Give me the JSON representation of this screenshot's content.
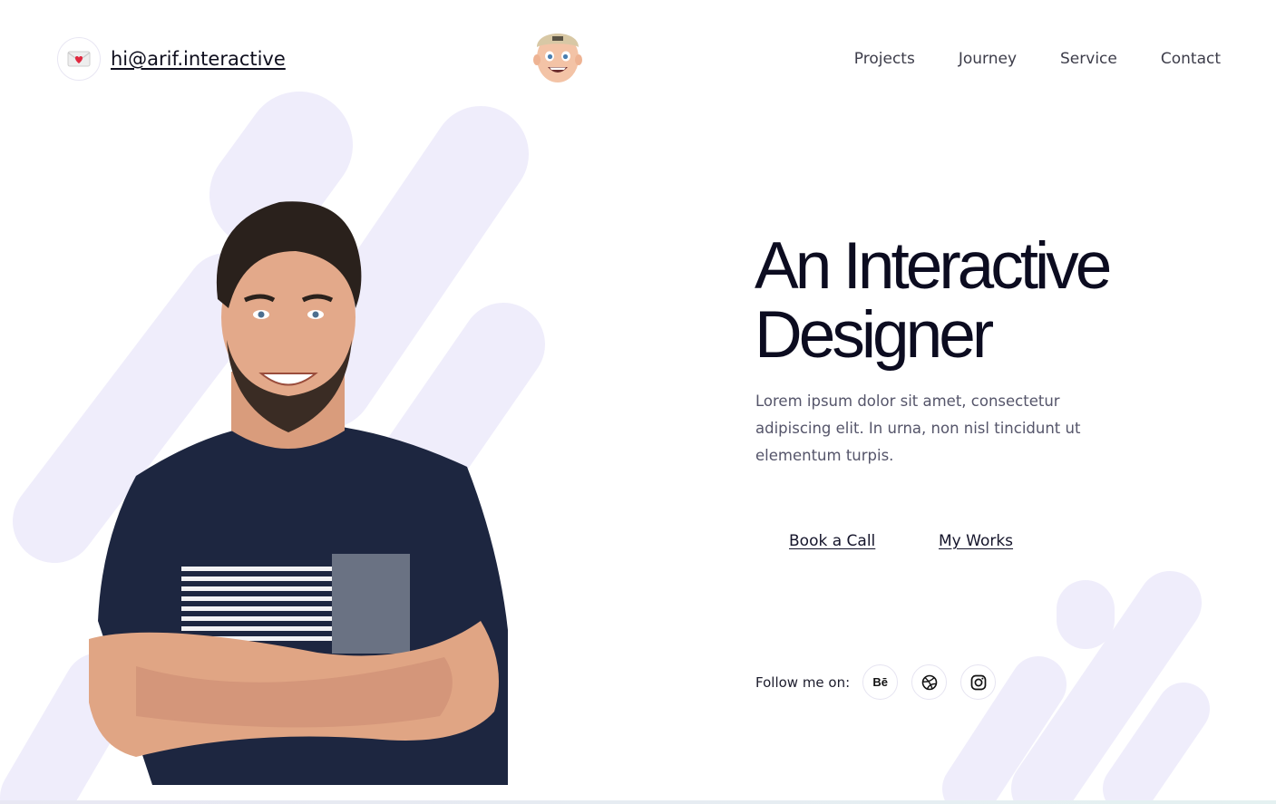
{
  "header": {
    "email": "hi@arif.interactive",
    "mail_icon": "envelope-heart-icon",
    "logo_icon": "memoji-avatar-icon"
  },
  "nav": {
    "items": [
      {
        "label": "Projects"
      },
      {
        "label": "Journey"
      },
      {
        "label": "Service"
      },
      {
        "label": "Contact"
      }
    ]
  },
  "hero": {
    "title_line1": "An Interactive",
    "title_line2": "Designer",
    "description": "Lorem ipsum dolor sit amet, consectetur adipiscing elit. In urna, non nisl tincidunt ut elementum turpis.",
    "primary_cta": "Book a Call",
    "secondary_cta": "My Works"
  },
  "follow": {
    "label": "Follow me on:",
    "behance_text": "Bē",
    "icons": [
      "behance-icon",
      "dribbble-icon",
      "instagram-icon"
    ]
  },
  "colors": {
    "accent_shape": "#efedfb",
    "text_dark": "#0c0c20",
    "text_muted": "#55556a",
    "shirt": "#1d2640"
  }
}
